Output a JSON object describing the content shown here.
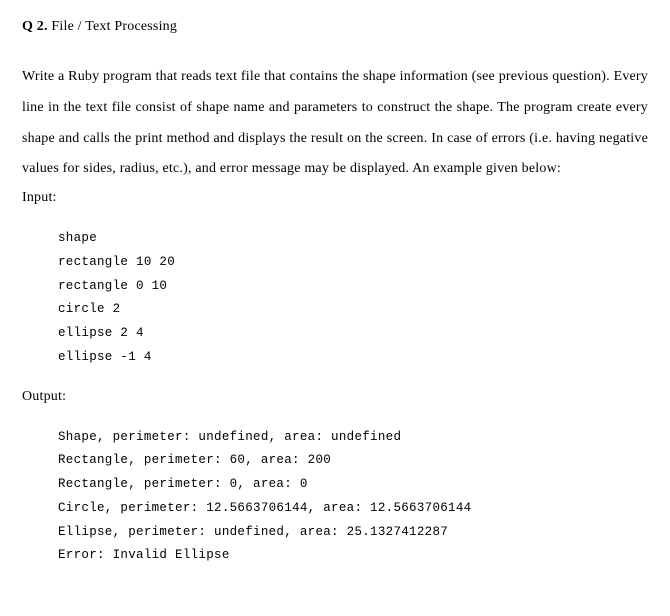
{
  "heading": {
    "qnum": "Q 2.",
    "title": "File / Text Processing"
  },
  "body": "Write a Ruby program that reads text file that contains the shape information (see previous question). Every line in the text file consist of shape name and parameters to construct the shape. The program create every shape and calls the print method and displays the result on the screen. In case of errors (i.e. having negative values for sides, radius, etc.), and error message may be displayed. An example given below:",
  "input_label": "Input:",
  "input_code": "shape\nrectangle 10 20\nrectangle 0 10\ncircle 2\nellipse 2 4\nellipse -1 4",
  "output_label": "Output:",
  "output_code": "Shape, perimeter: undefined, area: undefined\nRectangle, perimeter: 60, area: 200\nRectangle, perimeter: 0, area: 0\nCircle, perimeter: 12.5663706144, area: 12.5663706144\nEllipse, perimeter: undefined, area: 25.1327412287\nError: Invalid Ellipse"
}
